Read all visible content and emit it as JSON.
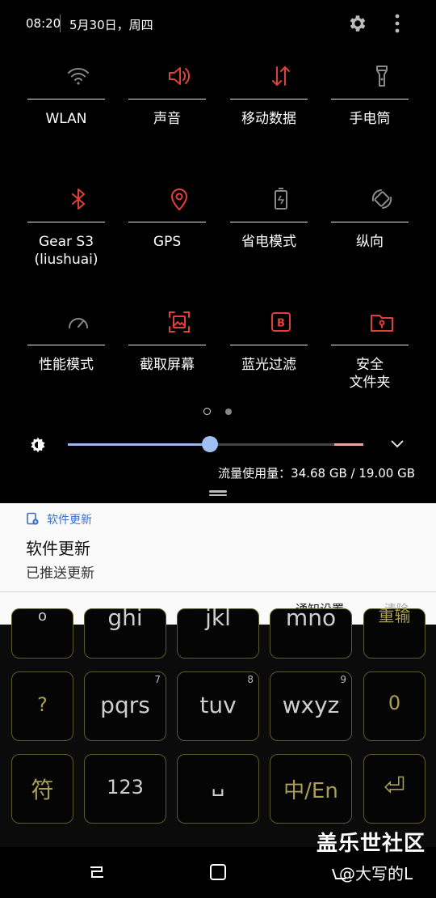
{
  "status_bar": {
    "time": "08:20",
    "date": "5月30日，周四"
  },
  "tiles": [
    {
      "label": "WLAN",
      "icon": "wifi-icon",
      "active": false
    },
    {
      "label": "声音",
      "icon": "volume-icon",
      "active": true
    },
    {
      "label": "移动数据",
      "icon": "mobile-data-icon",
      "active": true
    },
    {
      "label": "手电筒",
      "icon": "flashlight-icon",
      "active": false
    },
    {
      "label": "Gear S3\n(liushuai)",
      "icon": "bluetooth-icon",
      "active": true
    },
    {
      "label": "GPS",
      "icon": "location-icon",
      "active": true
    },
    {
      "label": "省电模式",
      "icon": "battery-saver-icon",
      "active": false
    },
    {
      "label": "纵向",
      "icon": "rotation-icon",
      "active": false
    },
    {
      "label": "性能模式",
      "icon": "performance-icon",
      "active": false
    },
    {
      "label": "截取屏幕",
      "icon": "screenshot-icon",
      "active": true
    },
    {
      "label": "蓝光过滤",
      "icon": "blue-light-filter-icon",
      "active": true
    },
    {
      "label": "安全\n文件夹",
      "icon": "secure-folder-icon",
      "active": true
    }
  ],
  "page_indicator": {
    "current": 1,
    "total": 2
  },
  "brightness": {
    "level": 0.48
  },
  "data_usage": "流量使用量：34.68 GB / 19.00 GB",
  "notification": {
    "app_name": "软件更新",
    "title": "软件更新",
    "text": "已推送更新",
    "settings_label": "通知设置",
    "clear_label": "清除"
  },
  "keyboard": {
    "row_top": [
      "o",
      "ghi",
      "jkl",
      "mno",
      "重输"
    ],
    "row_mid": [
      {
        "main": "?",
        "num": ""
      },
      {
        "main": "pqrs",
        "num": "7"
      },
      {
        "main": "tuv",
        "num": "8"
      },
      {
        "main": "wxyz",
        "num": "9"
      },
      {
        "main": "0",
        "num": ""
      }
    ],
    "row_bottom": [
      "符",
      "123",
      "␣",
      "中/En",
      "⏎"
    ]
  },
  "watermark": {
    "site": "盖乐世社区",
    "user": "@大写的L"
  },
  "colors": {
    "active": "#e0403a",
    "inactive": "#8a8a8a",
    "accent": "#3a6fc8"
  }
}
